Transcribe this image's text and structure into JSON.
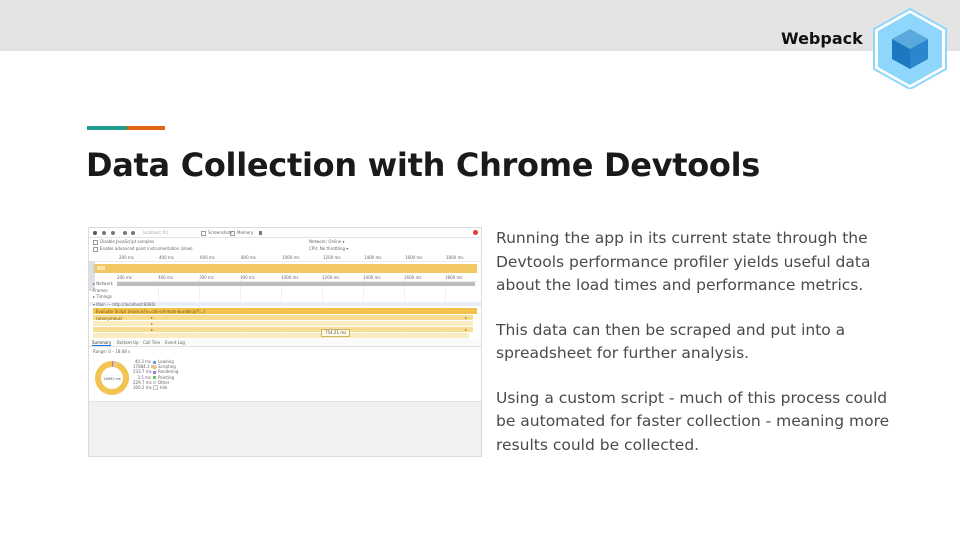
{
  "header": {
    "brand_label": "Webpack",
    "logo_icon": "webpack-cube-icon"
  },
  "colors": {
    "accent_teal": "#1e9c8f",
    "accent_orange": "#e06517",
    "topbar": "#e4e4e4",
    "webpack_light_blue": "#8ed6fb",
    "webpack_dark_blue": "#1c78c0"
  },
  "slide": {
    "title": "Data Collection with Chrome Devtools",
    "paragraphs": [
      "Running the app in its current state through the Devtools performance profiler yields useful data about the load times and performance metrics.",
      "This data can then be scraped and put into a spreadsheet for further analysis.",
      "Using a custom script - much of this process could be automated for faster collection - meaning more results could be collected."
    ]
  },
  "devtools": {
    "toolbar": {
      "url_placeholder": "localhost #1",
      "screenshots_label": "Screenshots",
      "memory_label": "Memory"
    },
    "options": {
      "disable_js_samples": "Disable JavaScript samples",
      "advanced_paint": "Enable advanced paint instrumentation (slow)",
      "network_label": "Network:",
      "network_value": "Online",
      "cpu_label": "CPU:",
      "cpu_value": "No throttling"
    },
    "ruler_ticks": [
      "200 ms",
      "400 ms",
      "600 ms",
      "800 ms",
      "1000 ms",
      "1200 ms",
      "1400 ms",
      "1600 ms",
      "1800 ms"
    ],
    "tracks": {
      "network": "Network",
      "frames": "Frames",
      "timings": "Timings",
      "main": "Main — http://localhost:8080/",
      "evaluate": "Evaluate Script (main.js?v=cdn-v4-main-bundle.js?!…)",
      "anonymous": "(anonymous)"
    },
    "tooltip": "754.21 ms",
    "tabs": [
      "Summary",
      "Bottom-Up",
      "Call Tree",
      "Event Log"
    ],
    "range": "Range: 0 – 18.68 s",
    "summary": {
      "total_label": "18691 ms",
      "rows": [
        {
          "value": "40.3 ms",
          "label": "Loading",
          "color": "#6a9be8"
        },
        {
          "value": "17884.3 ms",
          "label": "Scripting",
          "color": "#f1c453"
        },
        {
          "value": "233.7 ms",
          "label": "Rendering",
          "color": "#a07cd9"
        },
        {
          "value": "3.5 ms",
          "label": "Painting",
          "color": "#6cc06c"
        },
        {
          "value": "229.7 ms",
          "label": "Other",
          "color": "#d6d6d6"
        },
        {
          "value": "300.2 ms",
          "label": "Idle",
          "color": "#f4f4f4"
        }
      ]
    }
  }
}
